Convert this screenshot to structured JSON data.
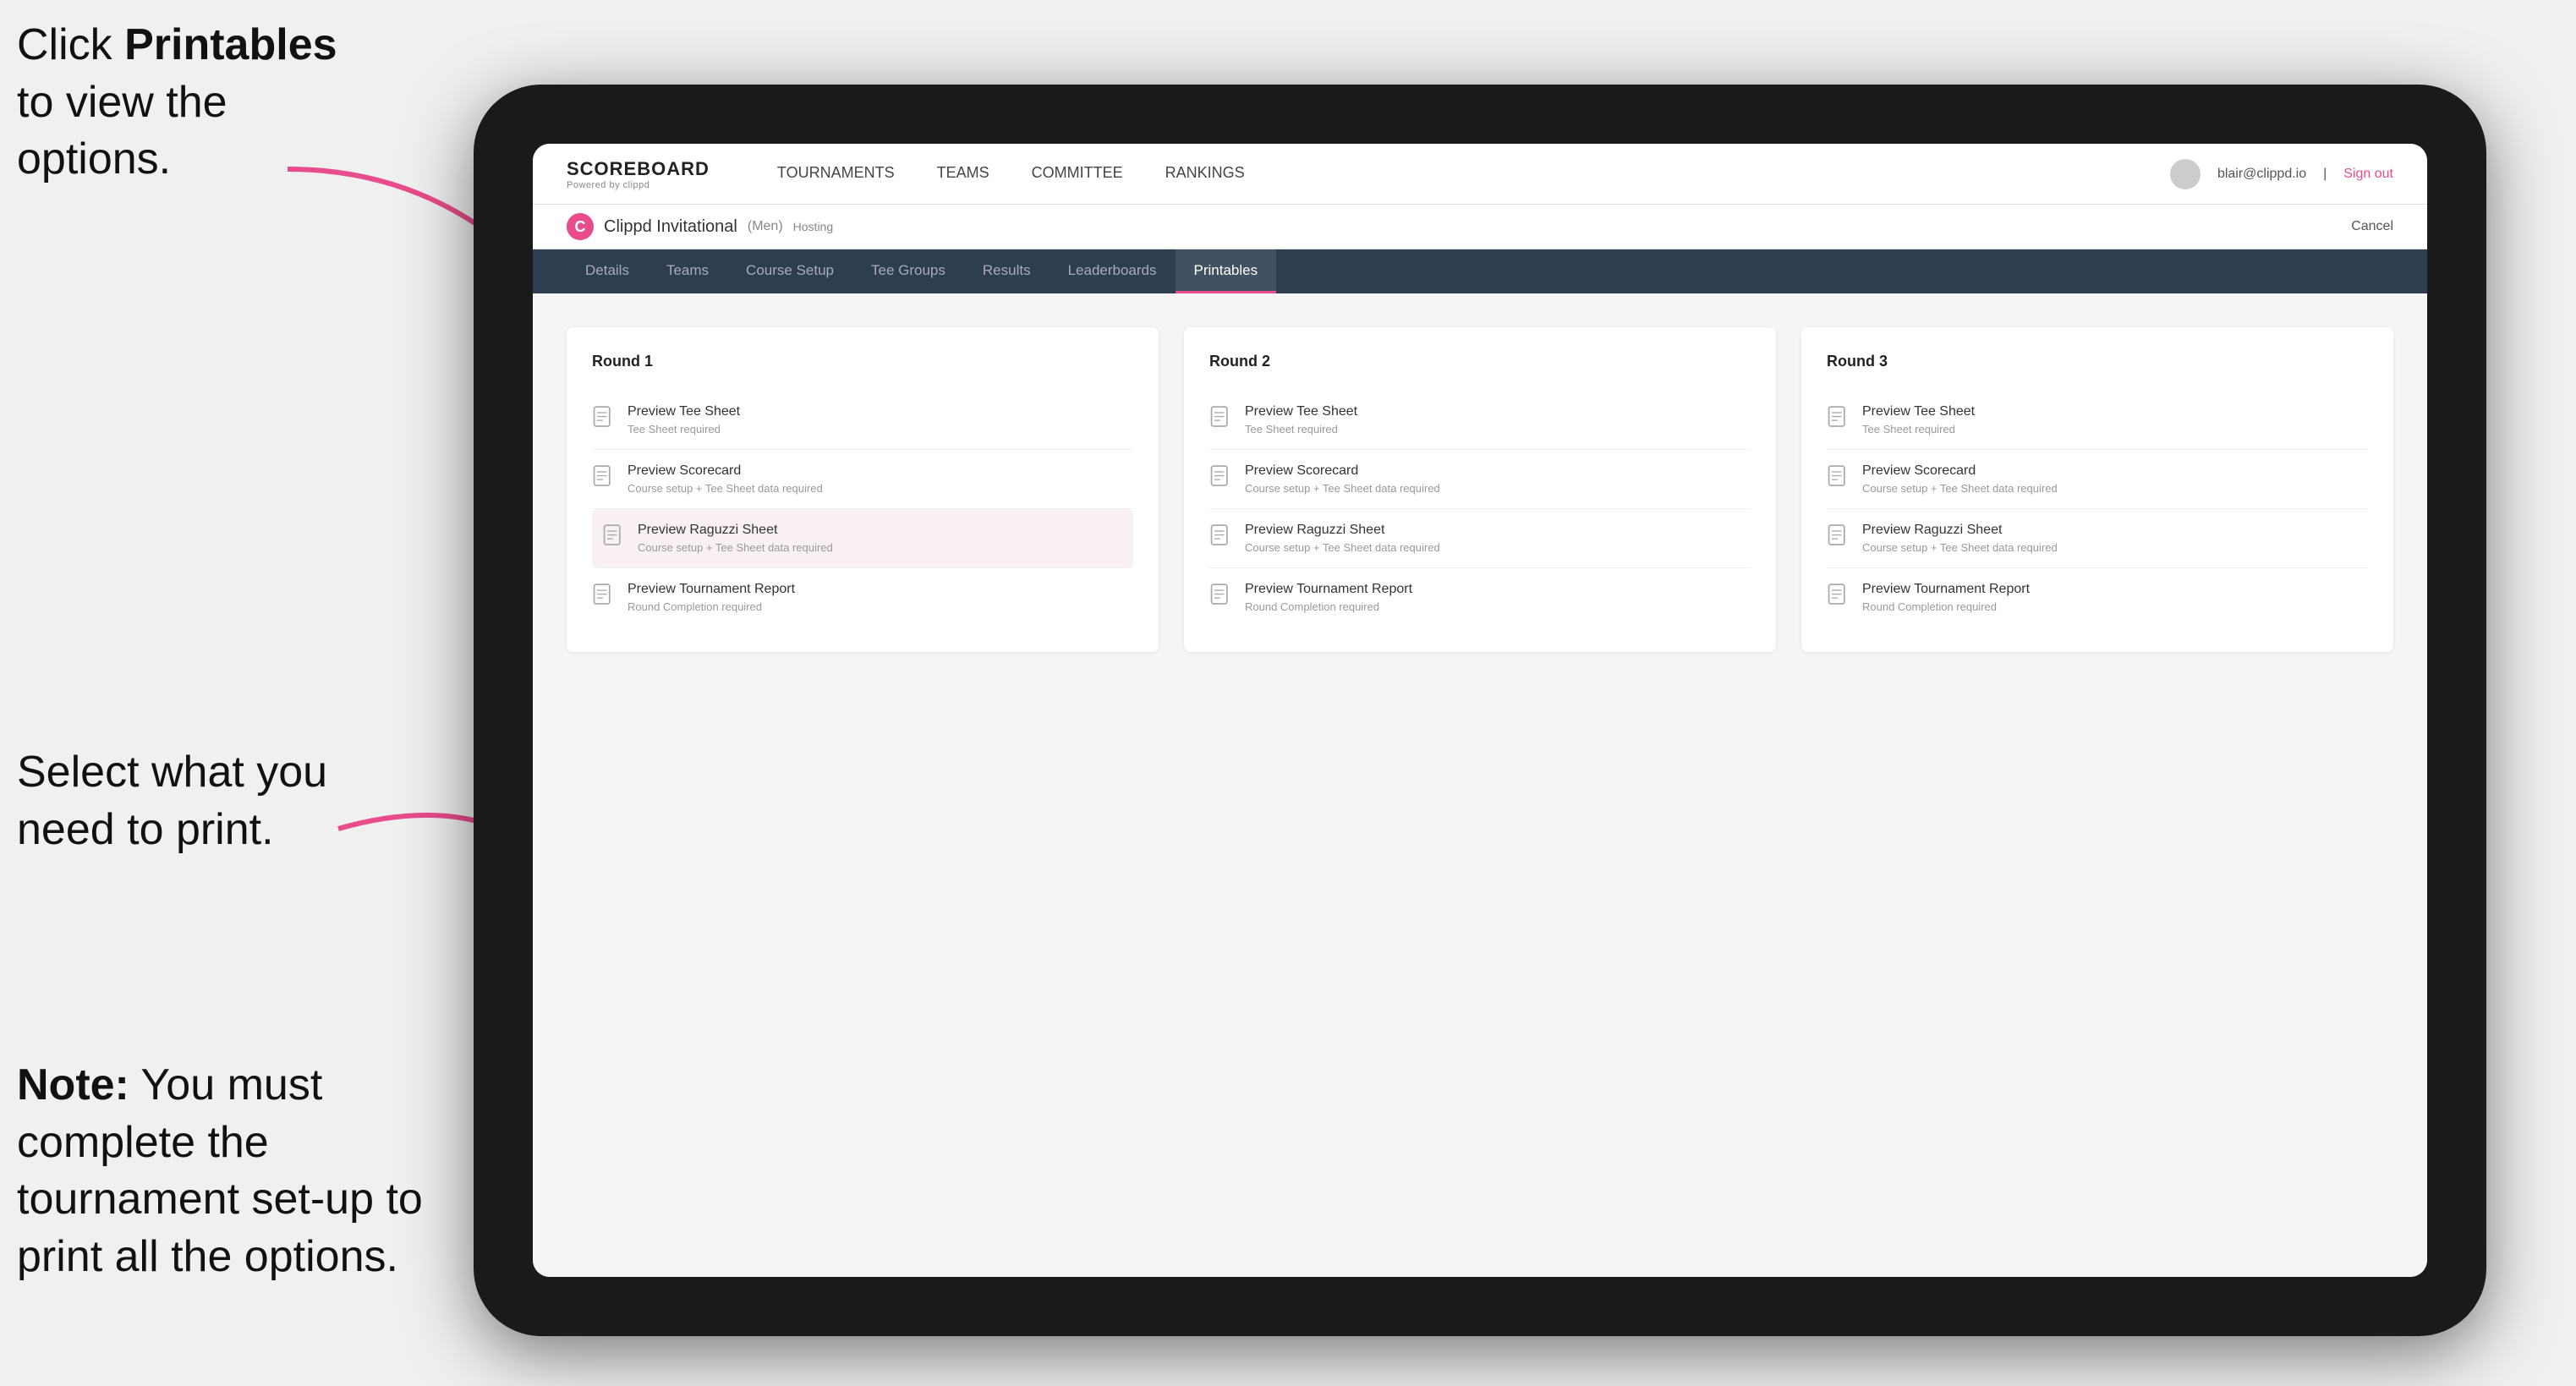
{
  "annotations": {
    "top": {
      "part1": "Click ",
      "bold": "Printables",
      "part2": " to view the options."
    },
    "mid": "Select what you need to print.",
    "bottom": {
      "bold": "Note:",
      "text": " You must complete the tournament set-up to print all the options."
    }
  },
  "nav": {
    "logo": "SCOREBOARD",
    "logo_sub": "Powered by clippd",
    "links": [
      "TOURNAMENTS",
      "TEAMS",
      "COMMITTEE",
      "RANKINGS"
    ],
    "user_email": "blair@clippd.io",
    "sign_out": "Sign out"
  },
  "tournament": {
    "name": "Clippd Invitational",
    "category": "Men",
    "status": "Hosting",
    "cancel": "Cancel"
  },
  "sub_tabs": [
    "Details",
    "Teams",
    "Course Setup",
    "Tee Groups",
    "Results",
    "Leaderboards",
    "Printables"
  ],
  "active_tab": "Printables",
  "rounds": [
    {
      "title": "Round 1",
      "items": [
        {
          "label": "Preview Tee Sheet",
          "sub": "Tee Sheet required"
        },
        {
          "label": "Preview Scorecard",
          "sub": "Course setup + Tee Sheet data required"
        },
        {
          "label": "Preview Raguzzi Sheet",
          "sub": "Course setup + Tee Sheet data required"
        },
        {
          "label": "Preview Tournament Report",
          "sub": "Round Completion required"
        }
      ]
    },
    {
      "title": "Round 2",
      "items": [
        {
          "label": "Preview Tee Sheet",
          "sub": "Tee Sheet required"
        },
        {
          "label": "Preview Scorecard",
          "sub": "Course setup + Tee Sheet data required"
        },
        {
          "label": "Preview Raguzzi Sheet",
          "sub": "Course setup + Tee Sheet data required"
        },
        {
          "label": "Preview Tournament Report",
          "sub": "Round Completion required"
        }
      ]
    },
    {
      "title": "Round 3",
      "items": [
        {
          "label": "Preview Tee Sheet",
          "sub": "Tee Sheet required"
        },
        {
          "label": "Preview Scorecard",
          "sub": "Course setup + Tee Sheet data required"
        },
        {
          "label": "Preview Raguzzi Sheet",
          "sub": "Course setup + Tee Sheet data required"
        },
        {
          "label": "Preview Tournament Report",
          "sub": "Round Completion required"
        }
      ]
    }
  ],
  "colors": {
    "accent": "#e84c8b",
    "nav_bg": "#2c3e50"
  }
}
